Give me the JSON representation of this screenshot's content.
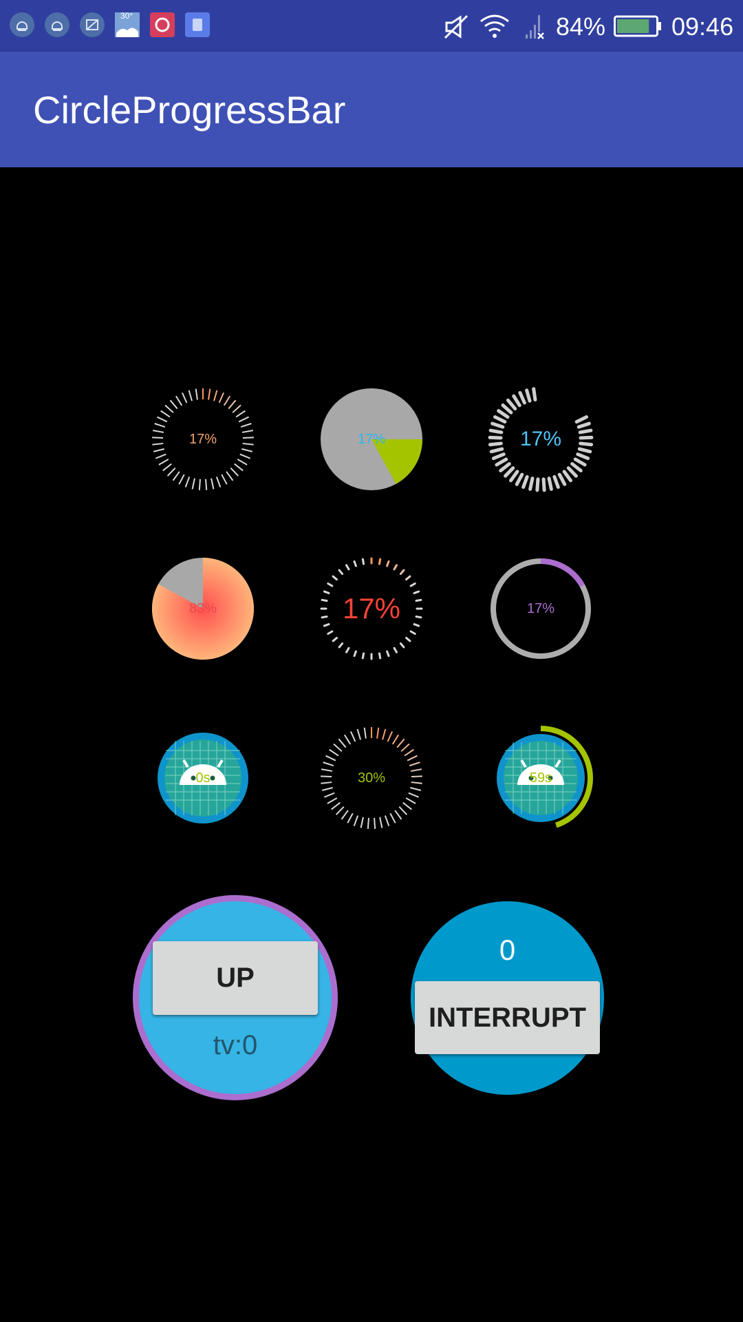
{
  "status_bar": {
    "battery_percent": "84%",
    "battery_level": 0.84,
    "time": "09:46",
    "weather_badge": "30°",
    "notification_icons": [
      "android-icon",
      "android-icon",
      "screenshot-icon",
      "weather-icon",
      "app-red-icon",
      "app-blue-icon"
    ],
    "system_icons": [
      "mute-icon",
      "wifi-icon",
      "no-signal-icon",
      "battery-icon"
    ]
  },
  "app_bar": {
    "title": "CircleProgressBar"
  },
  "progress_grid": [
    {
      "style": "line-ticks-gradient",
      "label": "17%",
      "progress": 0.17,
      "label_color": "#F5A468"
    },
    {
      "style": "pie-sector",
      "label": "17%",
      "progress": 0.17,
      "label_color": "#29B6F6",
      "track_color": "#A8A8A8",
      "fill_color": "#A4C400"
    },
    {
      "style": "solid-line-ticks",
      "label": "17%",
      "progress": 0.17,
      "label_color": "#4FC3F7"
    },
    {
      "style": "pie-gradient",
      "label": "83%",
      "progress": 0.83,
      "label_color": "#E84A4A"
    },
    {
      "style": "dot-ticks",
      "label": "17%",
      "progress": 0.17,
      "label_color": "#F44336"
    },
    {
      "style": "ring",
      "label": "17%",
      "progress": 0.17,
      "label_color": "#AB6ECF",
      "track_color": "#ADADAD",
      "fill_color": "#AB6ECF"
    },
    {
      "style": "image-timer",
      "label": "0s",
      "progress": 0,
      "label_color": "#A4C400"
    },
    {
      "style": "line-ticks-gradient",
      "label": "30%",
      "progress": 0.3,
      "label_color": "#A4C400"
    },
    {
      "style": "image-timer-ring",
      "label": "59s",
      "progress": 0.45,
      "label_color": "#A4C400",
      "fill_color": "#A4C400"
    }
  ],
  "up_panel": {
    "button_label": "UP",
    "value_text": "tv:0",
    "ring_color": "#AB6ECF",
    "fill_color": "#36B4E5"
  },
  "interrupt_panel": {
    "counter": "0",
    "button_label": "INTERRUPT",
    "fill_color": "#0099CC"
  }
}
